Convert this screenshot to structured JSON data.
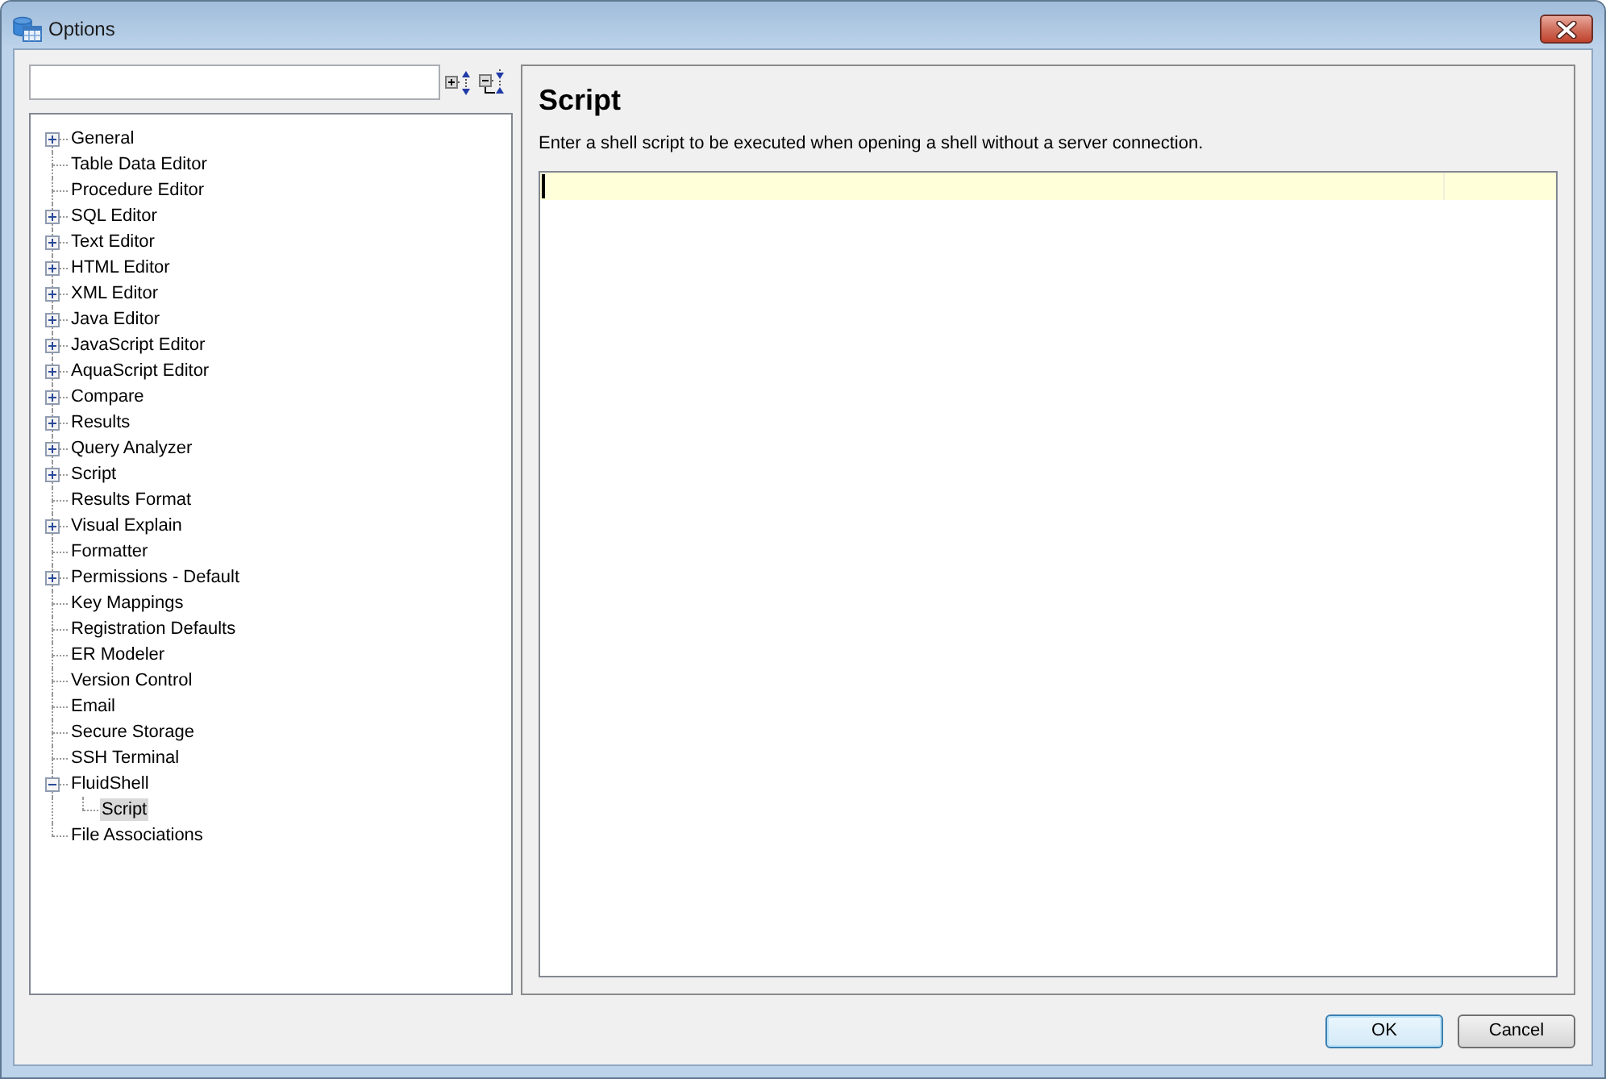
{
  "window": {
    "title": "Options"
  },
  "tree": {
    "items": [
      {
        "label": "General",
        "expanded": false,
        "selected": false
      },
      {
        "label": "Table Data Editor",
        "selected": false
      },
      {
        "label": "Procedure Editor",
        "selected": false
      },
      {
        "label": "SQL Editor",
        "expanded": false,
        "selected": false
      },
      {
        "label": "Text Editor",
        "expanded": false,
        "selected": false
      },
      {
        "label": "HTML Editor",
        "expanded": false,
        "selected": false
      },
      {
        "label": "XML Editor",
        "expanded": false,
        "selected": false
      },
      {
        "label": "Java Editor",
        "expanded": false,
        "selected": false
      },
      {
        "label": "JavaScript Editor",
        "expanded": false,
        "selected": false
      },
      {
        "label": "AquaScript Editor",
        "expanded": false,
        "selected": false
      },
      {
        "label": "Compare",
        "expanded": false,
        "selected": false
      },
      {
        "label": "Results",
        "expanded": false,
        "selected": false
      },
      {
        "label": "Query Analyzer",
        "expanded": false,
        "selected": false
      },
      {
        "label": "Script",
        "expanded": false,
        "selected": false
      },
      {
        "label": "Results Format",
        "selected": false
      },
      {
        "label": "Visual Explain",
        "expanded": false,
        "selected": false
      },
      {
        "label": "Formatter",
        "selected": false
      },
      {
        "label": "Permissions - Default",
        "expanded": false,
        "selected": false
      },
      {
        "label": "Key Mappings",
        "selected": false
      },
      {
        "label": "Registration Defaults",
        "selected": false
      },
      {
        "label": "ER Modeler",
        "selected": false
      },
      {
        "label": "Version Control",
        "selected": false
      },
      {
        "label": "Email",
        "selected": false
      },
      {
        "label": "Secure Storage",
        "selected": false
      },
      {
        "label": "SSH Terminal",
        "selected": false
      },
      {
        "label": "FluidShell",
        "expanded": true,
        "selected": false,
        "children": [
          {
            "label": "Script",
            "selected": true
          }
        ]
      },
      {
        "label": "File Associations",
        "selected": false
      }
    ]
  },
  "page": {
    "heading": "Script",
    "description": "Enter a shell script to be executed when opening a shell without a server connection."
  },
  "buttons": [
    {
      "label": "OK",
      "default": true
    },
    {
      "label": "Cancel",
      "default": false
    }
  ]
}
